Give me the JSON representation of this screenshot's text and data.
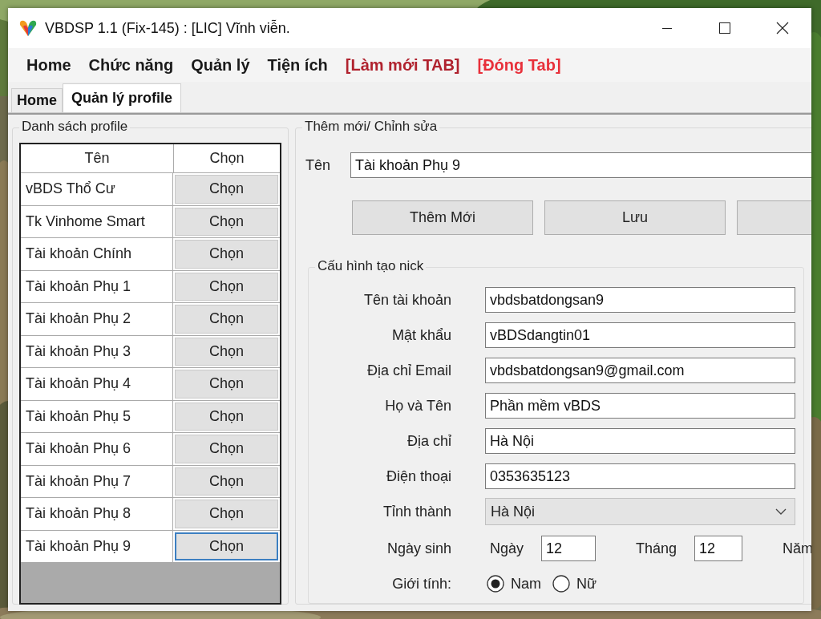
{
  "window": {
    "title": "VBDSP 1.1 (Fix-145) : [LIC] Vĩnh viễn."
  },
  "menu": [
    {
      "label": "Home",
      "color": "#1a1a1a"
    },
    {
      "label": "Chức năng",
      "color": "#1a1a1a"
    },
    {
      "label": "Quản lý",
      "color": "#1a1a1a"
    },
    {
      "label": "Tiện ích",
      "color": "#1a1a1a"
    },
    {
      "label": "[Làm mới TAB]",
      "color": "#b0222e"
    },
    {
      "label": "[Đóng Tab]",
      "color": "#e8303a"
    }
  ],
  "tabs": [
    {
      "label": "Home",
      "selected": false
    },
    {
      "label": "Quản lý profile",
      "selected": true
    }
  ],
  "profile_list": {
    "title": "Danh sách profile",
    "columns": [
      "Tên",
      "Chọn"
    ],
    "rows": [
      {
        "name": "vBDS Thổ Cư",
        "button": "Chọn",
        "focused": false
      },
      {
        "name": "Tk Vinhome Smart",
        "button": "Chọn",
        "focused": false
      },
      {
        "name": "Tài khoản Chính",
        "button": "Chọn",
        "focused": false
      },
      {
        "name": "Tài khoản Phụ 1",
        "button": "Chọn",
        "focused": false
      },
      {
        "name": "Tài khoản Phụ 2",
        "button": "Chọn",
        "focused": false
      },
      {
        "name": "Tài khoản Phụ 3",
        "button": "Chọn",
        "focused": false
      },
      {
        "name": "Tài khoản Phụ 4",
        "button": "Chọn",
        "focused": false
      },
      {
        "name": "Tài khoản Phụ 5",
        "button": "Chọn",
        "focused": false
      },
      {
        "name": "Tài khoản Phụ 6",
        "button": "Chọn",
        "focused": false
      },
      {
        "name": "Tài khoản Phụ 7",
        "button": "Chọn",
        "focused": false
      },
      {
        "name": "Tài khoản Phụ 8",
        "button": "Chọn",
        "focused": false
      },
      {
        "name": "Tài khoản Phụ 9",
        "button": "Chọn",
        "focused": true
      }
    ]
  },
  "editor": {
    "title": "Thêm mới/ Chỉnh sửa",
    "name_label": "Tên",
    "name_value": "Tài khoản Phụ 9",
    "buttons": [
      {
        "kind": "full",
        "label": "Thêm Mới"
      },
      {
        "kind": "full",
        "label": "Lưu"
      },
      {
        "kind": "cut"
      }
    ]
  },
  "nick_config": {
    "title": "Cấu hình tạo nick",
    "fields": [
      {
        "kind": "text",
        "label": "Tên tài khoản",
        "value": "vbdsbatdongsan9"
      },
      {
        "kind": "text",
        "label": "Mật khẩu",
        "value": "vBDSdangtin01"
      },
      {
        "kind": "text",
        "label": "Địa chỉ Email",
        "value": "vbdsbatdongsan9@gmail.com"
      },
      {
        "kind": "text",
        "label": "Họ và Tên",
        "value": "Phần mềm vBDS"
      },
      {
        "kind": "text",
        "label": "Địa chỉ",
        "value": "Hà Nội"
      },
      {
        "kind": "text",
        "label": "Điện thoại",
        "value": "0353635123"
      },
      {
        "kind": "dropdown",
        "label": "Tỉnh thành",
        "value": "Hà Nội"
      }
    ],
    "birth": {
      "label": "Ngày sinh",
      "parts": [
        {
          "label": "Ngày",
          "value": "12"
        },
        {
          "label": "Tháng",
          "value": "12"
        },
        {
          "label": "Năm"
        }
      ]
    },
    "gender": {
      "label": "Giới tính:",
      "options": [
        {
          "label": "Nam",
          "selected": true
        },
        {
          "label": "Nữ",
          "selected": false
        }
      ]
    }
  }
}
